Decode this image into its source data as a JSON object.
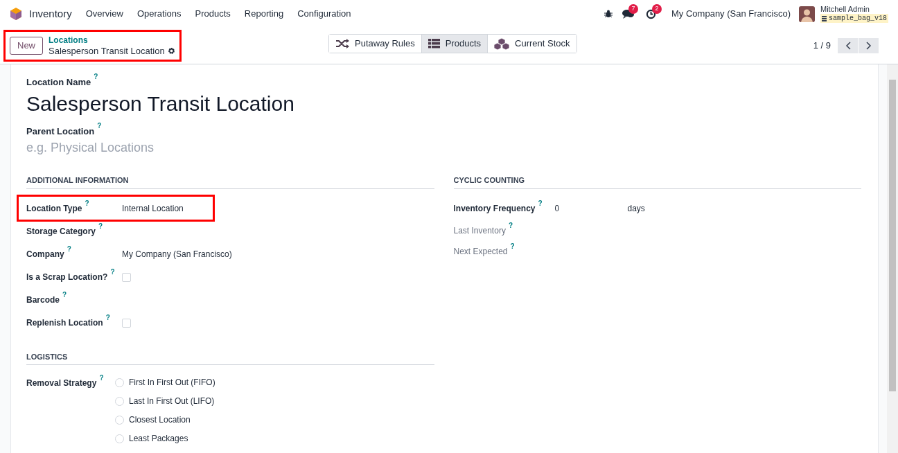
{
  "navbar": {
    "app": "Inventory",
    "menu": [
      "Overview",
      "Operations",
      "Products",
      "Reporting",
      "Configuration"
    ],
    "messages_count": "7",
    "activities_count": "2",
    "company": "My Company (San Francisco)",
    "user": "Mitchell Admin",
    "database": "sample_bag_v18"
  },
  "control_panel": {
    "new_button": "New",
    "breadcrumb_parent": "Locations",
    "breadcrumb_current": "Salesperson Transit Location",
    "highlighted": true,
    "smart_buttons": [
      {
        "label": "Putaway Rules",
        "kind": "shuffle",
        "selected": false
      },
      {
        "label": "Products",
        "kind": "list",
        "selected": true
      },
      {
        "label": "Current Stock",
        "kind": "boxes",
        "selected": false
      }
    ],
    "pager": "1 / 9"
  },
  "form": {
    "name_label": "Location Name",
    "name_help": "?",
    "name": "Salesperson Transit Location",
    "parent_label": "Parent Location",
    "parent_help": "?",
    "parent_placeholder": "e.g. Physical Locations",
    "additional": {
      "title": "ADDITIONAL INFORMATION",
      "fields": [
        {
          "label": "Location Type",
          "help": "?",
          "kind": "text",
          "value": "Internal Location",
          "highlighted": true
        },
        {
          "label": "Storage Category",
          "help": "?",
          "kind": "empty",
          "highlighted": false
        },
        {
          "label": "Company",
          "help": "?",
          "kind": "text",
          "value": "My Company (San Francisco)",
          "highlighted": false
        },
        {
          "label": "Is a Scrap Location?",
          "help": "?",
          "kind": "checkbox",
          "checked": false,
          "highlighted": false
        },
        {
          "label": "Barcode",
          "help": "?",
          "kind": "empty",
          "highlighted": false
        },
        {
          "label": "Replenish Location",
          "help": "?",
          "kind": "checkbox",
          "checked": false,
          "highlighted": false
        }
      ]
    },
    "cyclic": {
      "title": "CYCLIC COUNTING",
      "fields": [
        {
          "label": "Inventory Frequency",
          "help": "?",
          "kind": "number",
          "value": "0",
          "unit": "days",
          "readonly": false
        },
        {
          "label": "Last Inventory",
          "help": "?",
          "kind": "empty",
          "readonly": true
        },
        {
          "label": "Next Expected",
          "help": "?",
          "kind": "empty",
          "readonly": true
        }
      ]
    },
    "logistics": {
      "title": "LOGISTICS",
      "label": "Removal Strategy",
      "help": "?",
      "options": [
        {
          "label": "First In First Out (FIFO)",
          "selected": false
        },
        {
          "label": "Last In First Out (LIFO)",
          "selected": false
        },
        {
          "label": "Closest Location",
          "selected": false
        },
        {
          "label": "Least Packages",
          "selected": false
        }
      ]
    }
  }
}
